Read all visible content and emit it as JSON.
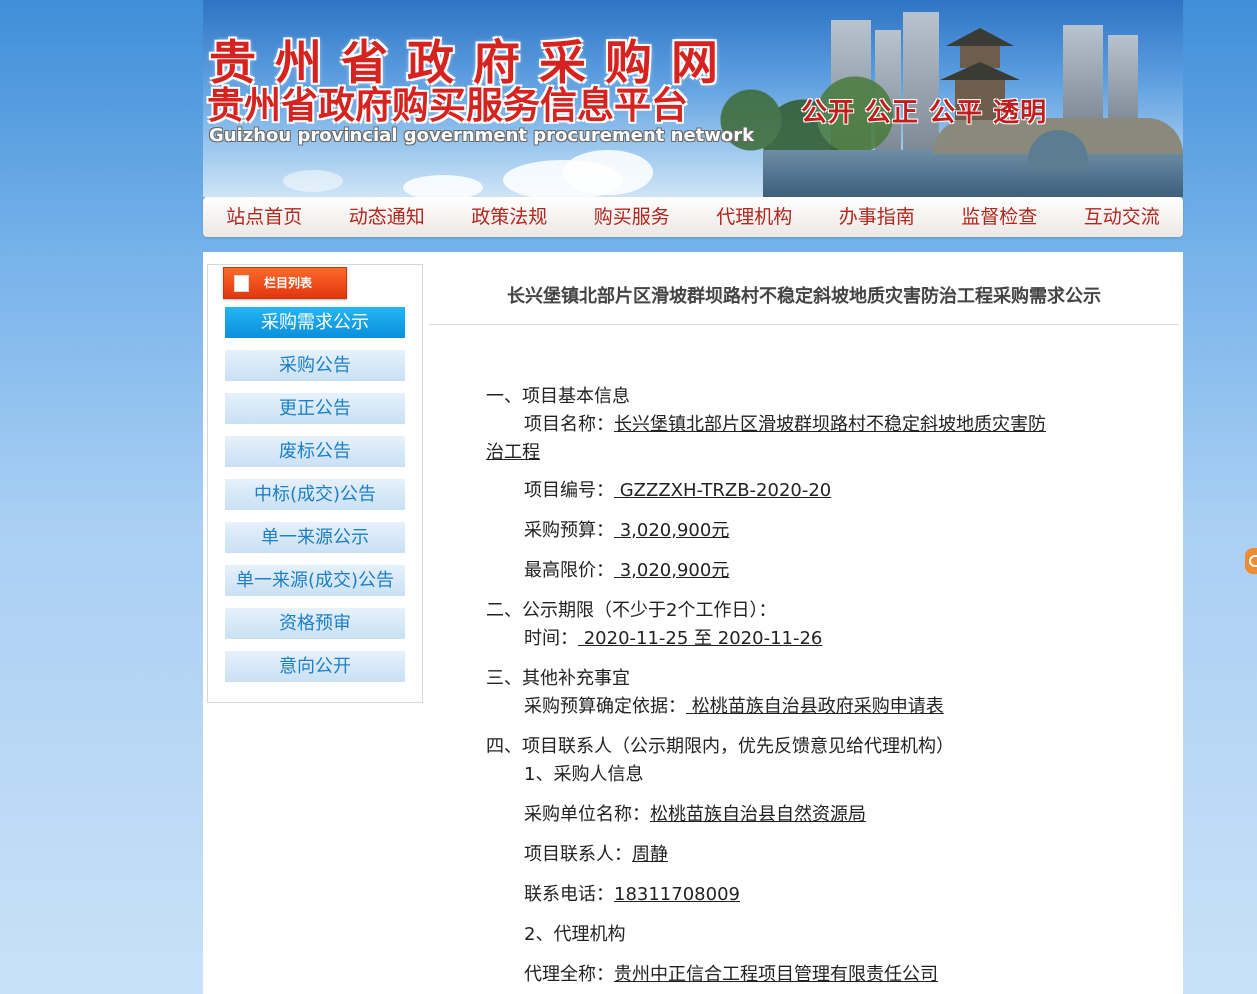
{
  "header": {
    "title_cn": "贵州省政府采购网",
    "subtitle_cn": "贵州省政府购买服务信息平台",
    "title_en": "Guizhou provincial government procurement network",
    "slogan": "公开 公正 公平 透明"
  },
  "nav": {
    "items": [
      "站点首页",
      "动态通知",
      "政策法规",
      "购买服务",
      "代理机构",
      "办事指南",
      "监督检查",
      "互动交流"
    ]
  },
  "sidebar": {
    "tab_label": "栏目列表",
    "items": [
      {
        "label": "采购需求公示",
        "active": true
      },
      {
        "label": "采购公告"
      },
      {
        "label": "更正公告"
      },
      {
        "label": "废标公告"
      },
      {
        "label": "中标(成交)公告"
      },
      {
        "label": "单一来源公示"
      },
      {
        "label": "单一来源(成交)公告"
      },
      {
        "label": "资格预审"
      },
      {
        "label": "意向公开"
      }
    ]
  },
  "article": {
    "title": "长兴堡镇北部片区滑坡群坝路村不稳定斜坡地质灾害防治工程采购需求公示",
    "s1_heading": "一、项目基本信息",
    "project_name_label": "项目名称：",
    "project_name_line1": "长兴堡镇北部片区滑坡群坝路村不稳定斜坡地质灾害防",
    "project_name_line2": "治工程",
    "project_no_label": "项目编号：",
    "project_no": " GZZZXH-TRZB-2020-20",
    "budget_label": "采购预算：",
    "budget": " 3,020,900元",
    "max_price_label": "最高限价：",
    "max_price": " 3,020,900元",
    "s2_heading": "二、公示期限（不少于2个工作日）：",
    "period_label": "时间：",
    "period": " 2020-11-25 至 2020-11-26",
    "s3_heading": "三、其他补充事宜",
    "basis_label": "采购预算确定依据：",
    "basis": " 松桃苗族自治县政府采购申请表",
    "s4_heading": "四、项目联系人（公示期限内，优先反馈意见给代理机构）",
    "purchaser_heading": "1、采购人信息",
    "purchaser_name_label": "采购单位名称：",
    "purchaser_name": "松桃苗族自治县自然资源局",
    "contact_label": "项目联系人：",
    "contact": "周静",
    "phone_label": "联系电话：",
    "phone": "18311708009",
    "agency_heading": "2、代理机构",
    "agency_name_label": "代理全称：",
    "agency_name": "贵州中正信合工程项目管理有限责任公司"
  }
}
